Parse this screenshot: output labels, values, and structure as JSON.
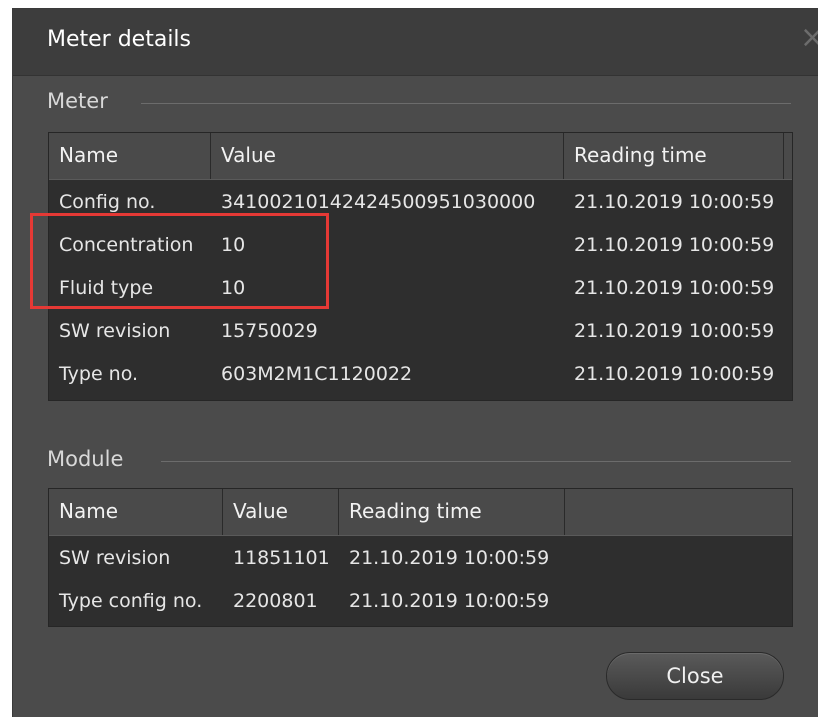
{
  "dialog": {
    "title": "Meter details",
    "close_glyph": "×"
  },
  "meter": {
    "label": "Meter",
    "columns": [
      "Name",
      "Value",
      "Reading time"
    ],
    "rows": [
      [
        "Config no.",
        "34100210142424500951030000",
        "21.10.2019 10:00:59"
      ],
      [
        "Concentration",
        "10",
        "21.10.2019 10:00:59"
      ],
      [
        "Fluid type",
        "10",
        "21.10.2019 10:00:59"
      ],
      [
        "SW revision",
        "15750029",
        "21.10.2019 10:00:59"
      ],
      [
        "Type no.",
        "603M2M1C1120022",
        "21.10.2019 10:00:59"
      ]
    ]
  },
  "module": {
    "label": "Module",
    "columns": [
      "Name",
      "Value",
      "Reading time"
    ],
    "rows": [
      [
        "SW revision",
        "11851101",
        "21.10.2019 10:00:59"
      ],
      [
        "Type config no.",
        "2200801",
        "21.10.2019 10:00:59"
      ]
    ]
  },
  "footer": {
    "close_label": "Close"
  },
  "colors": {
    "dialog_bg": "#4b4b4b",
    "grid_bg": "#2e2e2e",
    "header_bg": "#4a4a4a",
    "highlight": "#e53935"
  }
}
